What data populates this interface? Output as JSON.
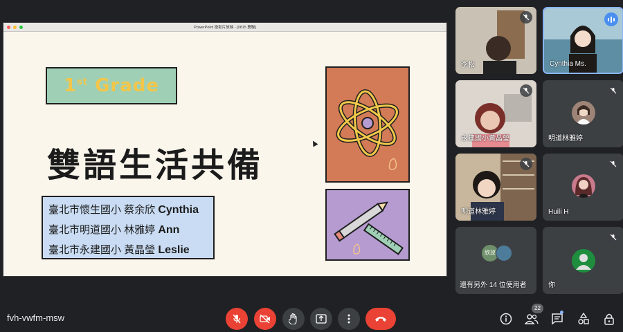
{
  "presentation": {
    "window_title": "PowerPoint 投影片放映 - [0815 雙聯]",
    "grade_label": "1st Grade",
    "grade_num": "1",
    "grade_suffix": "st",
    "grade_word": " Grade",
    "slide_title": "雙語生活共備",
    "names": [
      {
        "school": "臺北市懷生國小 蔡余欣",
        "en": "Cynthia"
      },
      {
        "school": "臺北市明道國小 林雅婷",
        "en": "Ann"
      },
      {
        "school": "臺北市永建國小 黃晶瑩",
        "en": "Leslie"
      }
    ]
  },
  "participants": [
    {
      "name": "李松",
      "muted": true
    },
    {
      "name": "Cynthia Ms.",
      "speaking": true
    },
    {
      "name": "永建國小黃晶瑩",
      "muted": true
    },
    {
      "name": "明道林雅婷",
      "muted": true
    },
    {
      "name": "明道林雅婷",
      "muted": true
    },
    {
      "name": "Huili H",
      "muted": true
    },
    {
      "name": "還有另外 14 位使用者",
      "avatar_label": "欣玫"
    },
    {
      "name": "你",
      "muted": true
    }
  ],
  "bottom_bar": {
    "meeting_code": "fvh-vwfm-msw",
    "people_count": "22"
  },
  "icons": [
    "mic-off-icon",
    "camera-off-icon",
    "raise-hand-icon",
    "present-icon",
    "more-icon",
    "end-call-icon",
    "info-icon",
    "people-icon",
    "chat-icon",
    "activities-icon",
    "host-controls-icon"
  ],
  "colors": {
    "end_call": "#ea4335",
    "speaking": "#4a8ef0",
    "grade_box": "#9fd0b5",
    "names_box": "#c9dcf3"
  }
}
